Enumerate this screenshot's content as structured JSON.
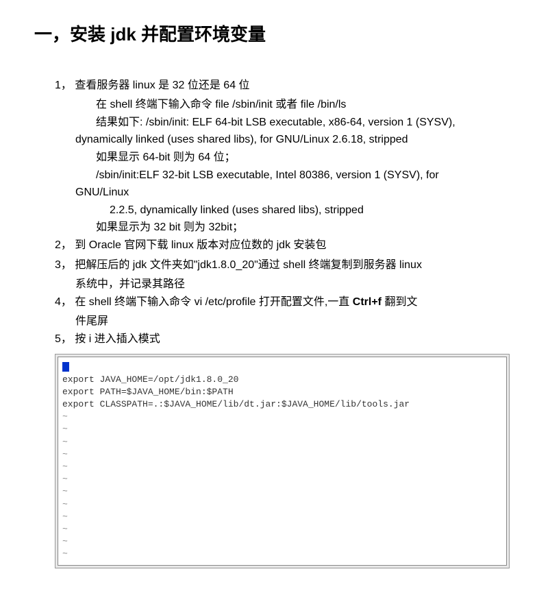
{
  "title": "一，安装 jdk 并配置环境变量",
  "item1": {
    "num": "1，",
    "text": "查看服务器 linux 是 32 位还是 64 位",
    "sub1": "在 shell 终端下输入命令 file /sbin/init  或者  file /bin/ls",
    "sub2": "结果如下: /sbin/init: ELF 64-bit LSB executable, x86-64, version 1 (SYSV),",
    "sub2b": "dynamically linked (uses shared libs), for GNU/Linux 2.6.18, stripped",
    "sub3": "如果显示  64-bit  则为 64 位；",
    "sub4": "/sbin/init:ELF  32-bit  LSB  executable,  Intel  80386,  version  1  (SYSV),  for",
    "sub4b": "GNU/Linux",
    "sub5": "2.2.5, dynamically linked (uses shared libs), stripped",
    "sub6": "如果显示为 32 bit  则为 32bit；"
  },
  "item2": {
    "num": "2，",
    "text": "到 Oracle 官网下载 linux 版本对应位数的 jdk 安装包"
  },
  "item3": {
    "num": "3，",
    "text": "把解压后的 jdk 文件夹如\"jdk1.8.0_20\"通过 shell 终端复制到服务器 linux",
    "text2": "系统中，并记录其路径"
  },
  "item4": {
    "num": "4，",
    "text": "在 shell 终端下输入命令 vi /etc/profile 打开配置文件,一直 Ctrl+f 翻到文",
    "text2": "件尾屏"
  },
  "item5": {
    "num": "5，",
    "text": "按 i 进入插入模式"
  },
  "terminal": {
    "line1": "export JAVA_HOME=/opt/jdk1.8.0_20",
    "line2": "export PATH=$JAVA_HOME/bin:$PATH",
    "line3": "export CLASSPATH=.:$JAVA_HOME/lib/dt.jar:$JAVA_HOME/lib/tools.jar",
    "tilde": "~"
  }
}
